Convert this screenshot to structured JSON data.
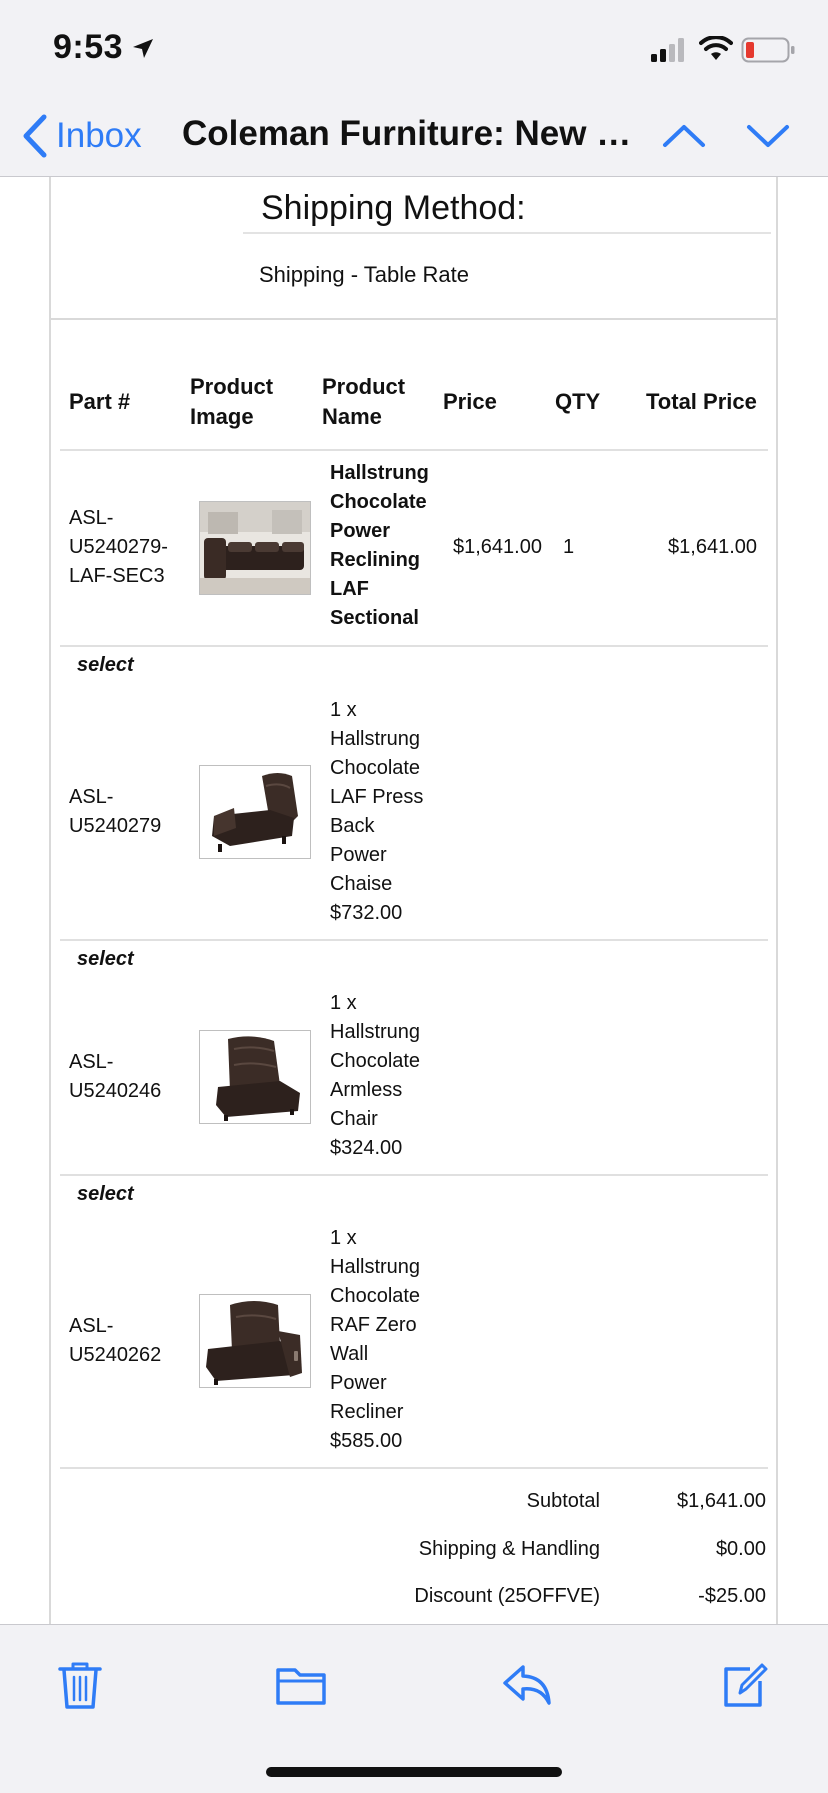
{
  "status": {
    "time": "9:53"
  },
  "nav": {
    "back_label": "Inbox",
    "title": "Coleman Furniture: New Or..."
  },
  "shipping": {
    "heading": "Shipping Method:",
    "value": "Shipping - Table Rate"
  },
  "table": {
    "headers": {
      "part": "Part #",
      "image_1": "Product",
      "image_2": "Image",
      "name_1": "Product",
      "name_2": "Name",
      "price": "Price",
      "qty": "QTY",
      "total": "Total Price"
    },
    "main_item": {
      "part_lines": [
        "ASL-",
        "U5240279-",
        "LAF-SEC3"
      ],
      "name_lines": [
        "Hallstrung",
        "Chocolate",
        "Power",
        "Reclining",
        "LAF",
        "Sectional"
      ],
      "price": "$1,641.00",
      "qty": "1",
      "total": "$1,641.00"
    },
    "select_label": "select",
    "sub_items": [
      {
        "part_lines": [
          "ASL-",
          "U5240279"
        ],
        "desc_lines": [
          "1 x",
          "Hallstrung",
          "Chocolate",
          "LAF Press",
          "Back",
          "Power",
          "Chaise",
          "$732.00"
        ],
        "image_icon": "chaise-icon"
      },
      {
        "part_lines": [
          "ASL-",
          "U5240246"
        ],
        "desc_lines": [
          "1 x",
          "Hallstrung",
          "Chocolate",
          "Armless",
          "Chair",
          "$324.00"
        ],
        "image_icon": "armless-chair-icon"
      },
      {
        "part_lines": [
          "ASL-",
          "U5240262"
        ],
        "desc_lines": [
          "1 x",
          "Hallstrung",
          "Chocolate",
          "RAF Zero",
          "Wall",
          "Power",
          "Recliner",
          "$585.00"
        ],
        "image_icon": "recliner-icon"
      }
    ]
  },
  "totals": {
    "subtotal_label": "Subtotal",
    "subtotal_value": "$1,641.00",
    "shipping_label": "Shipping & Handling",
    "shipping_value": "$0.00",
    "discount_label": "Discount (25OFFVE)",
    "discount_value": "-$25.00"
  },
  "colors": {
    "accent": "#2f7cf6",
    "bar_bg": "#f2f2f5",
    "battery_low": "#e5392f",
    "leather": "#2d211d"
  },
  "icons": [
    "location-arrow-icon",
    "cellular-signal-icon",
    "wifi-icon",
    "battery-icon",
    "chevron-left-icon",
    "chevron-up-icon",
    "chevron-down-icon",
    "trash-icon",
    "folder-icon",
    "reply-icon",
    "compose-icon"
  ]
}
